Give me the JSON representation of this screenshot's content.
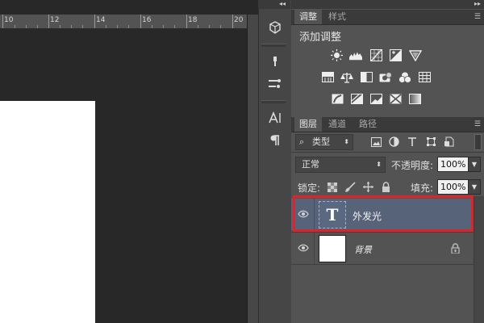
{
  "ruler": {
    "labels": [
      "10",
      "12",
      "14",
      "16",
      "18",
      "20"
    ]
  },
  "adjustments_panel": {
    "tabs": [
      {
        "label": "调整"
      },
      {
        "label": "样式"
      }
    ],
    "title": "添加调整"
  },
  "layers_panel": {
    "tabs": [
      {
        "label": "图层"
      },
      {
        "label": "通道"
      },
      {
        "label": "路径"
      }
    ],
    "filter": {
      "value": "类型"
    },
    "blend_mode": {
      "value": "正常"
    },
    "opacity": {
      "label": "不透明度:",
      "value": "100%"
    },
    "lock": {
      "label": "锁定:"
    },
    "fill": {
      "label": "填充:",
      "value": "100%"
    },
    "layers": [
      {
        "name": "外发光",
        "type": "text",
        "selected": true
      },
      {
        "name": "背景",
        "type": "background",
        "selected": false,
        "locked": true
      }
    ]
  },
  "colors": {
    "selection_highlight": "#e0222a",
    "selected_row": "#566378",
    "panel": "#535353"
  }
}
